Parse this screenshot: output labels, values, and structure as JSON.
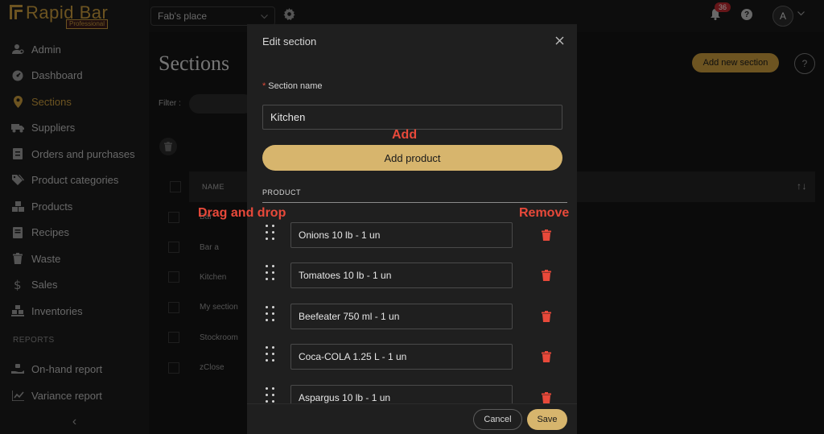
{
  "app": {
    "logo_text": "Rapid Bar",
    "logo_badge": "Professional"
  },
  "sidebar": {
    "items": [
      {
        "label": "Admin",
        "icon": "user-cog-icon"
      },
      {
        "label": "Dashboard",
        "icon": "gauge-icon"
      },
      {
        "label": "Sections",
        "icon": "map-pin-icon",
        "active": true
      },
      {
        "label": "Suppliers",
        "icon": "truck-icon"
      },
      {
        "label": "Orders and purchases",
        "icon": "box-icon"
      },
      {
        "label": "Product categories",
        "icon": "tags-icon"
      },
      {
        "label": "Products",
        "icon": "boxes-icon"
      },
      {
        "label": "Recipes",
        "icon": "book-icon"
      },
      {
        "label": "Waste",
        "icon": "trash-icon"
      },
      {
        "label": "Sales",
        "icon": "dollar-icon"
      },
      {
        "label": "Inventories",
        "icon": "warehouse-icon"
      }
    ],
    "reports_label": "REPORTS",
    "report_items": [
      {
        "label": "On-hand report",
        "icon": "hand-icon"
      },
      {
        "label": "Variance report",
        "icon": "chart-icon"
      }
    ],
    "collapse_icon": "‹"
  },
  "topbar": {
    "venue": "Fab's place",
    "notification_count": "36",
    "avatar_initial": "A"
  },
  "main": {
    "title": "Sections",
    "add_section_label": "Add new section",
    "help_glyph": "?",
    "filter_label": "Filter :",
    "table": {
      "header_name": "NAME",
      "rows": [
        "Bar",
        "Bar a",
        "Kitchen",
        "My section",
        "Stockroom",
        "zClose"
      ]
    }
  },
  "modal": {
    "title": "Edit section",
    "field_label": "Section name",
    "section_name_value": "Kitchen",
    "add_product_label": "Add product",
    "column_header": "PRODUCT",
    "products": [
      "Onions 10 lb - 1 un",
      "Tomatoes 10 lb - 1 un",
      "Beefeater 750 ml - 1 un",
      "Coca-COLA 1.25 L - 1 un",
      "Aspargus 10 lb - 1 un"
    ],
    "cancel_label": "Cancel",
    "save_label": "Save"
  },
  "annotations": {
    "add": "Add",
    "drag_and_drop": "Drag and drop",
    "remove": "Remove"
  },
  "colors": {
    "accent_gold": "#c79a3c",
    "button_gold": "#d7b56d",
    "danger_red": "#e8493a",
    "modal_bg": "#1f1f1f"
  }
}
